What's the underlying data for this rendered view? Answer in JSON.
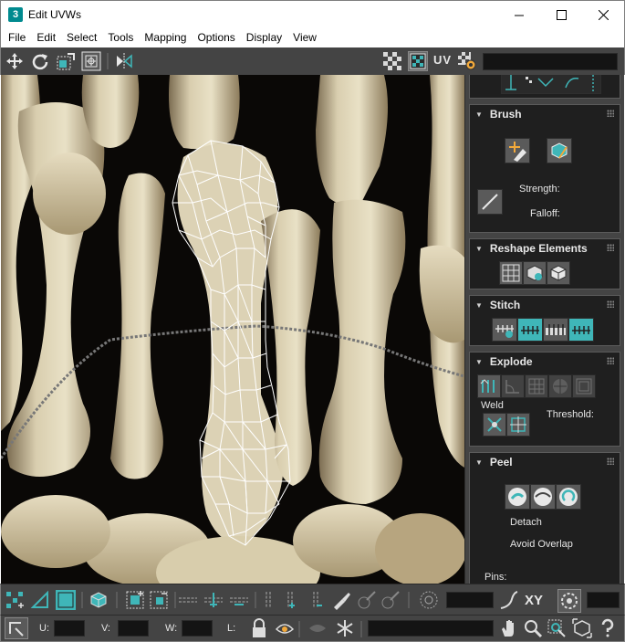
{
  "window": {
    "app_icon_text": "3",
    "title": "Edit UVWs",
    "controls": [
      "minimize-icon",
      "maximize-icon",
      "close-icon"
    ]
  },
  "menu": {
    "items": [
      "File",
      "Edit",
      "Select",
      "Tools",
      "Mapping",
      "Options",
      "Display",
      "View"
    ]
  },
  "top_toolbar": {
    "uv_label": "UV",
    "texture_dropdown_value": "",
    "icons": [
      "move-icon",
      "rotate-icon",
      "scale-icon",
      "freeform-icon",
      "mirror-icon",
      "checker-pattern-icon",
      "show-map-icon",
      "texture-settings-icon"
    ]
  },
  "right_panel": {
    "rollouts": {
      "brush": {
        "title": "Brush",
        "strength_label": "Strength:",
        "falloff_label": "Falloff:"
      },
      "reshape": {
        "title": "Reshape Elements"
      },
      "stitch": {
        "title": "Stitch"
      },
      "explode": {
        "title": "Explode",
        "weld_label": "Weld",
        "threshold_label": "Threshold:"
      },
      "peel": {
        "title": "Peel",
        "detach_label": "Detach",
        "avoid_overlap_label": "Avoid Overlap",
        "pins_label": "Pins:"
      }
    }
  },
  "bottom_toolbar": {
    "xy_label": "XY",
    "fields": {
      "value_1": "",
      "value_2": "",
      "value_3": ""
    }
  },
  "status_bar": {
    "u_label": "U:",
    "v_label": "V:",
    "w_label": "W:",
    "l_label": "L:",
    "u_value": "",
    "v_value": "",
    "w_value": "",
    "l_value": ""
  },
  "colors": {
    "ui_dark": "#444444",
    "panel_bg": "#1f1f1f",
    "accent_teal": "#3fb6b8",
    "mesh_wire": "#ffffff"
  }
}
